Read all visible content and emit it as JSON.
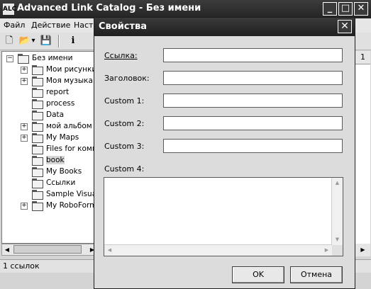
{
  "main": {
    "title": "Advanced Link Catalog - Без имени",
    "app_icon": "ALC",
    "controls": {
      "minimize": "_",
      "maximize": "□",
      "close": "✕"
    },
    "menu": [
      "Файл",
      "Действие",
      "Наст"
    ],
    "toolbar": {
      "icons": [
        "new-icon",
        "open-folder-icon",
        "save-icon",
        "info-icon"
      ],
      "glyphs": {
        "new": "🗋",
        "open": "📂",
        "dropdown": "▾",
        "save": "💾",
        "info": "i"
      }
    },
    "tree": {
      "root": "Без имени",
      "items": [
        {
          "label": "Мои рисунки",
          "expandable": true
        },
        {
          "label": "Моя музыка",
          "expandable": true
        },
        {
          "label": "report",
          "expandable": false
        },
        {
          "label": "process",
          "expandable": false
        },
        {
          "label": "Data",
          "expandable": false
        },
        {
          "label": "мой альбом",
          "expandable": true
        },
        {
          "label": "My Maps",
          "expandable": true
        },
        {
          "label": "Files for комп",
          "expandable": false
        },
        {
          "label": "book",
          "expandable": false,
          "selected": true
        },
        {
          "label": "My Books",
          "expandable": false
        },
        {
          "label": "Ссылки",
          "expandable": false
        },
        {
          "label": "Sample Visual",
          "expandable": false
        },
        {
          "label": "My RoboForm",
          "expandable": true
        }
      ]
    },
    "right_column_header": "1",
    "status": "1 ссылок"
  },
  "dialog": {
    "title": "Свойства",
    "close": "✕",
    "fields": {
      "link": {
        "label": "Ссылка:",
        "value": ""
      },
      "heading": {
        "label": "Заголовок:",
        "value": ""
      },
      "custom1": {
        "label": "Custom 1:",
        "value": ""
      },
      "custom2": {
        "label": "Custom 2:",
        "value": ""
      },
      "custom3": {
        "label": "Custom 3:",
        "value": ""
      }
    },
    "custom4_label": "Custom 4:",
    "custom4_value": "",
    "ok": "OK",
    "cancel": "Отмена"
  }
}
